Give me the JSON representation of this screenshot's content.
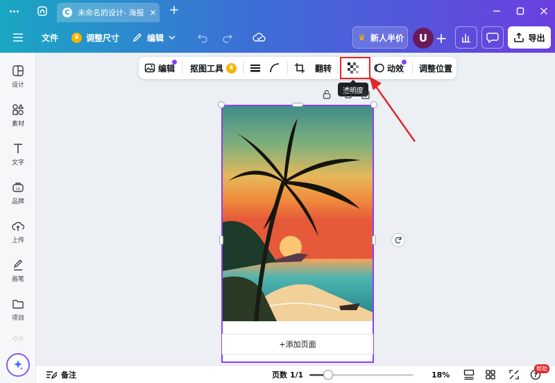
{
  "window": {
    "tab_title": "未命名的设计- 海报",
    "tab_logo": "C",
    "tab_close": "×",
    "new_tab": "+"
  },
  "header": {
    "file": "文件",
    "resize": "调整尺寸",
    "edit": "编辑",
    "promo": "新人半价",
    "avatar": "U",
    "add": "+",
    "export": "导出"
  },
  "sidebar": {
    "items": [
      {
        "label": "设计",
        "icon": "layout-icon"
      },
      {
        "label": "素材",
        "icon": "elements-icon"
      },
      {
        "label": "文字",
        "icon": "text-icon"
      },
      {
        "label": "品牌",
        "icon": "brand-icon"
      },
      {
        "label": "上传",
        "icon": "upload-icon"
      },
      {
        "label": "画笔",
        "icon": "draw-icon"
      },
      {
        "label": "项目",
        "icon": "folder-icon"
      }
    ]
  },
  "toolbar": {
    "edit": "编辑",
    "bg_remover": "抠图工具",
    "flip": "翻转",
    "animate": "动效",
    "position": "调整位置",
    "tooltip": "透明度"
  },
  "canvas": {
    "add_page": "+添加页面"
  },
  "bottom": {
    "notes": "备注",
    "pages": "页数 1/1",
    "zoom": "18%",
    "zoom_fraction": 0.18,
    "help": "帮助"
  },
  "colors": {
    "accent": "#8b3dff",
    "highlight": "#e0262b",
    "header_start": "#1aa7c4",
    "header_end": "#6b3fe0"
  }
}
